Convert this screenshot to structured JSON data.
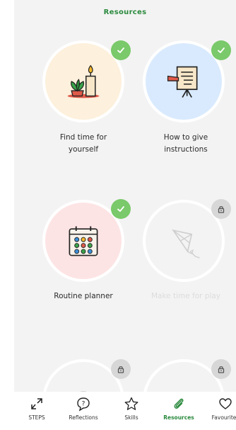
{
  "header": {
    "title": "Resources"
  },
  "tiles": [
    {
      "label_line1": "Find time for",
      "label_line2": "yourself",
      "status": "completed",
      "icon": "candle-plant-icon",
      "bg": "#fdf0dc"
    },
    {
      "label_line1": "How to give",
      "label_line2": "instructions",
      "status": "completed",
      "icon": "presentation-board-icon",
      "bg": "#d9eafe"
    },
    {
      "label_line1": "Routine planner",
      "label_line2": "",
      "status": "completed",
      "icon": "calendar-icon",
      "bg": "#fde4e4"
    },
    {
      "label_line1": "Make time for play",
      "label_line2": "",
      "status": "locked",
      "icon": "kite-icon",
      "bg": "#f3f3f3"
    },
    {
      "label_line1": "",
      "label_line2": "",
      "status": "locked",
      "icon": "clock-icon",
      "bg": "#f3f3f3"
    },
    {
      "label_line1": "",
      "label_line2": "",
      "status": "locked",
      "icon": "chat-bubble-icon",
      "bg": "#f3f3f3"
    }
  ],
  "tabbar": {
    "tabs": [
      {
        "label": "STEPS",
        "icon": "steps-arrows-icon",
        "active": false
      },
      {
        "label": "Reflections",
        "icon": "question-bubble-icon",
        "active": false
      },
      {
        "label": "Skills",
        "icon": "star-icon",
        "active": false
      },
      {
        "label": "Resources",
        "icon": "paperclip-icon",
        "active": true
      },
      {
        "label": "Favourites",
        "icon": "heart-icon",
        "active": false
      }
    ]
  },
  "colors": {
    "accent": "#2b8a3e",
    "check": "#7ac96a",
    "lock": "#d7d7d7"
  }
}
